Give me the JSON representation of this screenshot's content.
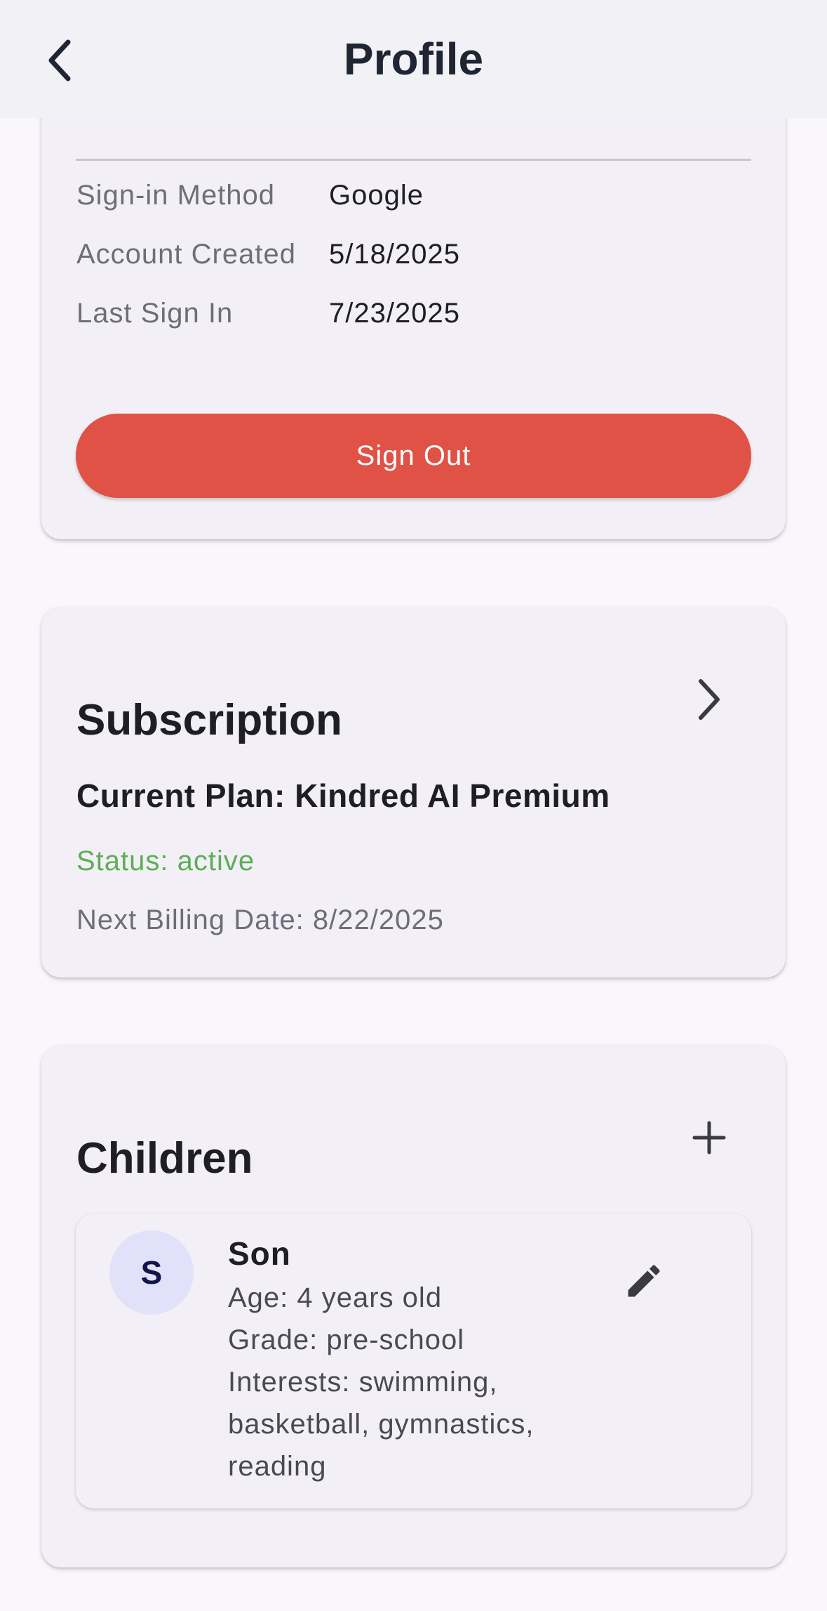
{
  "header": {
    "title": "Profile",
    "back_icon": "chevron-left-icon"
  },
  "account": {
    "rows": [
      {
        "label": "Sign-in Method",
        "value": "Google"
      },
      {
        "label": "Account Created",
        "value": "5/18/2025"
      },
      {
        "label": "Last Sign In",
        "value": "7/23/2025"
      }
    ],
    "sign_out_label": "Sign Out",
    "sign_out_color": "#E05245"
  },
  "subscription": {
    "heading": "Subscription",
    "chevron_icon": "chevron-right-icon",
    "plan": "Current Plan: Kindred AI Premium",
    "status": "Status: active",
    "status_color": "#5DAE56",
    "next_billing": "Next Billing Date: 8/22/2025"
  },
  "children": {
    "heading": "Children",
    "add_icon": "plus-icon",
    "items": [
      {
        "avatar_initial": "S",
        "name": "Son",
        "age": "Age: 4 years old",
        "grade": "Grade: pre-school",
        "interests": "Interests: swimming, basketball, gymnastics, reading",
        "edit_icon": "pencil-icon"
      }
    ]
  }
}
